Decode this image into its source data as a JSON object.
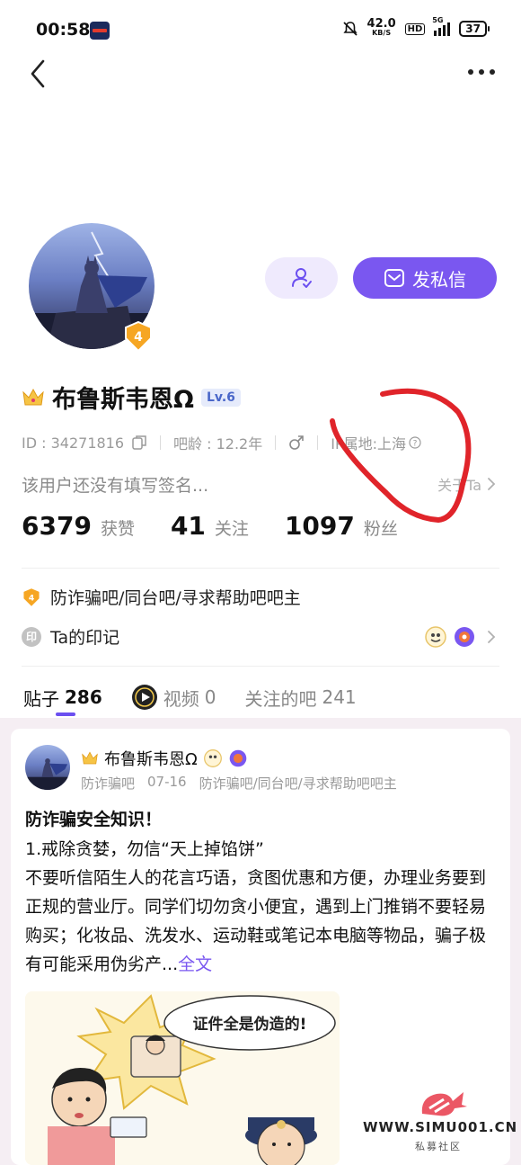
{
  "status_bar": {
    "time": "00:58",
    "net_speed": "42.0",
    "net_unit": "KB/S",
    "hd": "HD",
    "network": "5G",
    "battery": "37"
  },
  "profile": {
    "name": "布鲁斯韦恩Ω",
    "level": "Lv.6",
    "avatar_level": "4",
    "id_label": "ID : 34271816",
    "bar_age": "吧龄 : 12.2年",
    "ip_location": "IP属地:上海",
    "signature": "该用户还没有填写签名...",
    "about": "关于Ta",
    "message_button": "发私信"
  },
  "stats": [
    {
      "value": "6379",
      "label": "获赞"
    },
    {
      "value": "41",
      "label": "关注"
    },
    {
      "value": "1097",
      "label": "粉丝"
    }
  ],
  "moderator": {
    "badge": "4",
    "text": "防诈骗吧/同台吧/寻求帮助吧吧主"
  },
  "marks": {
    "icon": "印",
    "label": "Ta的印记"
  },
  "tabs": [
    {
      "label": "贴子",
      "count": "286",
      "active": true
    },
    {
      "label": "视频",
      "count": "0",
      "active": false
    },
    {
      "label": "关注的吧",
      "count": "241",
      "active": false
    }
  ],
  "post": {
    "author": "布鲁斯韦恩Ω",
    "forum": "防诈骗吧",
    "date": "07-16",
    "role": "防诈骗吧/同台吧/寻求帮助吧吧主",
    "title": "防诈骗安全知识！",
    "subtitle": "1.戒除贪婪，勿信“天上掉馅饼”",
    "body": "不要听信陌生人的花言巧语，贪图优惠和方便，办理业务要到正规的营业厅。同学们切勿贪小便宜，遇到上门推销不要轻易购买；化妆品、洗发水、运动鞋或笔记本电脑等物品，骗子极有可能采用伪劣产...",
    "read_more": "全文",
    "image_caption": "证件全是伪造的!"
  },
  "watermark": {
    "domain": "WWW.SIMU001.CN",
    "sub": "私募社区"
  },
  "colors": {
    "accent": "#7a57f0",
    "annotation": "#e0242a"
  }
}
